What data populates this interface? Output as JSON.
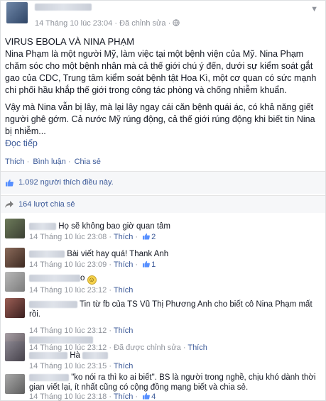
{
  "post": {
    "timestamp": "14 Tháng 10 lúc 23:04",
    "separator": "·",
    "edited": "Đã chỉnh sửa",
    "globe_icon": "globe-icon",
    "title": "VIRUS EBOLA VÀ NINA PHẠM",
    "paragraph1": "Nina Phạm là một người Mỹ, làm việc tại một bệnh viện của Mỹ. Nina Phạm chăm sóc cho một bệnh nhân mà cả thế giới chú ý đến, dưới sự kiểm soát gắt gao của CDC, Trung tâm kiểm soát bệnh tật Hoa Kì, một cơ quan có sức mạnh chi phối hầu khắp thế giới trong công tác phòng và chống nhiễm khuẩn.",
    "paragraph2": "Vậy mà Nina vẫn bị lây, mà lại lây ngay cái căn bệnh quái ác, có khả năng giết người ghê gớm. Cả nước Mỹ rúng động, cả thế giới rúng động khi biết tin Nina bị nhiễm...",
    "see_more": "Đọc tiếp"
  },
  "actions": {
    "like": "Thích",
    "comment": "Bình luận",
    "share": "Chia sẻ",
    "dot": "·"
  },
  "likes_summary": "1.092 người thích điều này.",
  "shares_summary": "164 lượt chia sẻ",
  "comments": [
    {
      "text": "Họ sẽ không bao giờ quan tâm",
      "time": "14 Tháng 10 lúc 23:08",
      "like": "Thích",
      "count": "2",
      "edited": ""
    },
    {
      "text": "Bài viết hay quá! Thank Anh",
      "time": "14 Tháng 10 lúc 23:09",
      "like": "Thích",
      "count": "1",
      "edited": ""
    },
    {
      "text": "o",
      "time": "14 Tháng 10 lúc 23:12",
      "like": "Thích",
      "count": "",
      "edited": ""
    },
    {
      "text": "Tin từ fb của TS Vũ Thị Phương Anh cho biết cô Nina Phạm mất rồi.",
      "time": "14 Tháng 10 lúc 23:12",
      "like": "Thích",
      "count": "",
      "edited": ""
    },
    {
      "text": "",
      "time": "14 Tháng 10 lúc 23:12",
      "like": "Thích",
      "count": "",
      "edited": "Đã được chỉnh sửa"
    },
    {
      "text": "Hà",
      "time": "14 Tháng 10 lúc 23:15",
      "like": "Thích",
      "count": "",
      "edited": ""
    },
    {
      "text": "\"ko nói ra thì ko ai biết\". BS là người trong nghề, chịu khó dành thời gian viết lại, ít nhất cũng có cộng đồng mạng biết và chia sẻ.",
      "time": "14 Tháng 10 lúc 23:18",
      "like": "Thích",
      "count": "4",
      "edited": ""
    }
  ],
  "colors": {
    "link": "#3b5998",
    "meta": "#90949c",
    "text": "#141823"
  }
}
